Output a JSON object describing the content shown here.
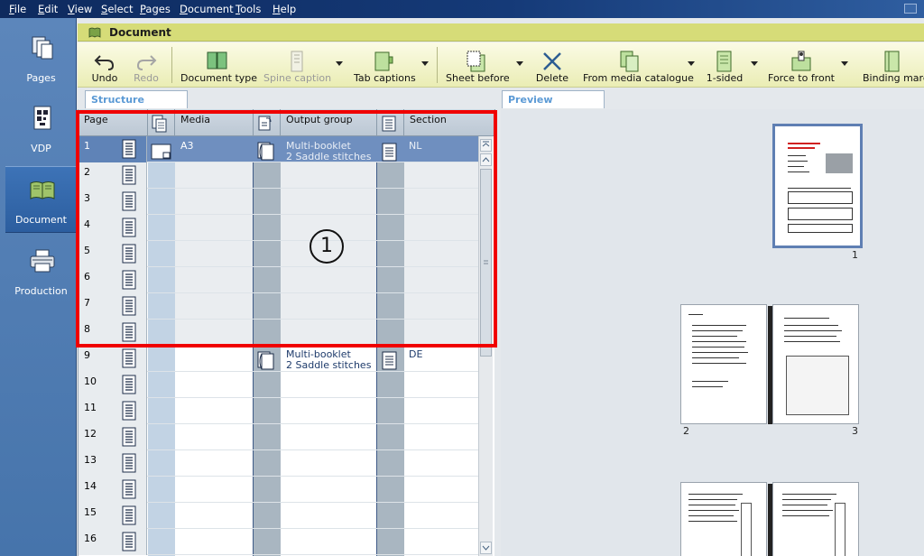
{
  "menu": {
    "items": [
      {
        "first": "F",
        "rest": "ile"
      },
      {
        "first": "E",
        "rest": "dit"
      },
      {
        "first": "V",
        "rest": "iew"
      },
      {
        "first": "S",
        "rest": "elect"
      },
      {
        "first": "P",
        "rest": "ages"
      },
      {
        "first": "D",
        "rest": "ocument"
      },
      {
        "first": "T",
        "rest": "ools"
      },
      {
        "first": "H",
        "rest": "elp"
      }
    ]
  },
  "nav": {
    "items": [
      {
        "label": "Pages",
        "icon": "pages-icon"
      },
      {
        "label": "VDP",
        "icon": "vdp-icon"
      },
      {
        "label": "Document",
        "icon": "document-book-icon"
      },
      {
        "label": "Production",
        "icon": "printer-icon"
      }
    ],
    "active": "Document"
  },
  "panel": {
    "title": "Document"
  },
  "toolbar": {
    "undo": "Undo",
    "redo": "Redo",
    "document_type": "Document type",
    "spine_caption": "Spine caption",
    "tab_captions": "Tab captions",
    "sheet_before": "Sheet before",
    "delete": "Delete",
    "from_media_catalogue": "From media catalogue",
    "one_sided": "1-sided",
    "force_to_front": "Force to front",
    "binding_margin": "Binding margin"
  },
  "tabs": {
    "structure": "Structure",
    "preview": "Preview"
  },
  "grid": {
    "headers": {
      "page": "Page",
      "media": "Media",
      "output_group": "Output group",
      "section": "Section"
    },
    "pages": [
      "1",
      "2",
      "3",
      "4",
      "5",
      "6",
      "7",
      "8",
      "9",
      "10",
      "11",
      "12",
      "13",
      "14",
      "15",
      "16"
    ],
    "selected_page": "1",
    "media_value": "A3",
    "output_groups": [
      {
        "line1": "Multi-booklet",
        "line2": "2 Saddle stitches"
      },
      {
        "line1": "Multi-booklet",
        "line2": "2 Saddle stitches"
      }
    ],
    "sections": [
      "NL",
      "DE"
    ]
  },
  "callout": "1",
  "preview": {
    "page_numbers": [
      "1",
      "2",
      "3"
    ]
  },
  "colors": {
    "highlight": "#f00000",
    "selection": "#6f8fbf",
    "nav": "#4674ab"
  }
}
